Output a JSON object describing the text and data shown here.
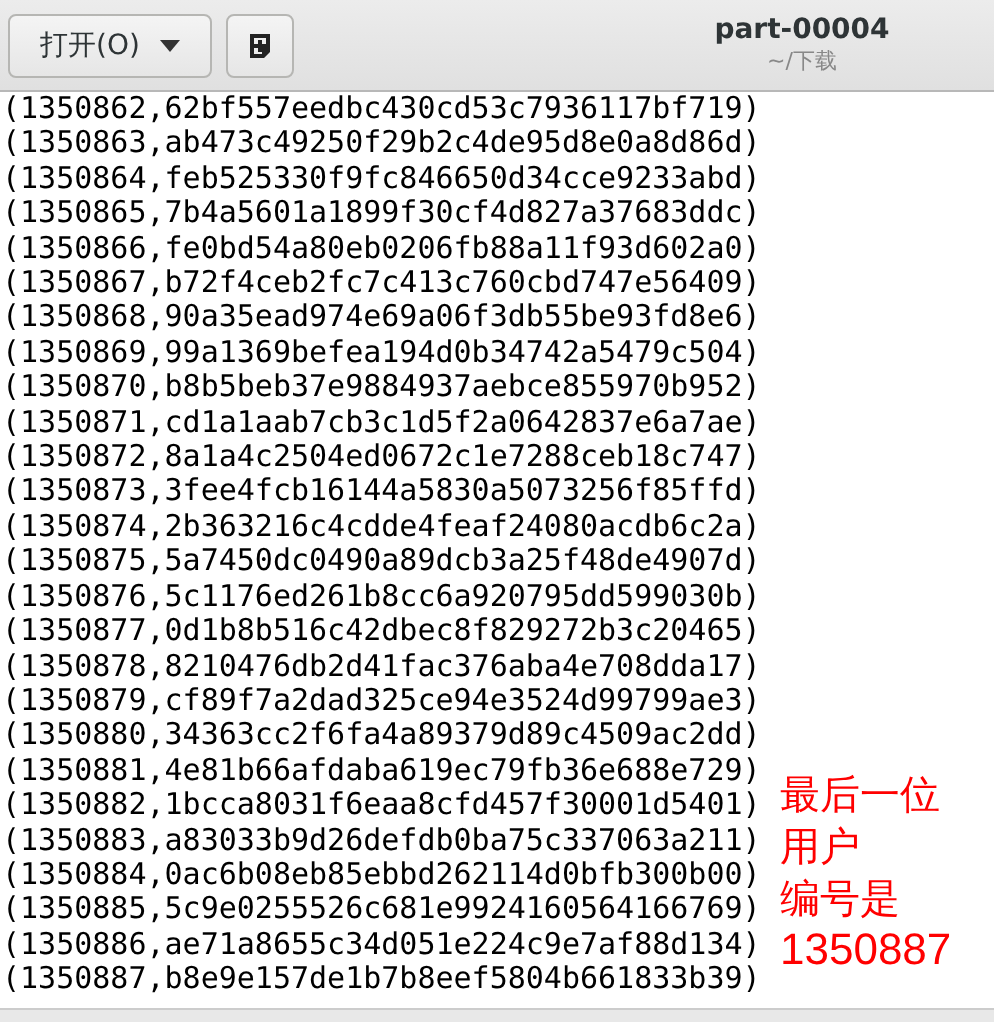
{
  "header_bar": {
    "open_button": {
      "label": "打开(O)"
    },
    "title": "part-00004",
    "subtitle": "~/下载"
  },
  "lines": [
    "(1350862,62bf557eedbc430cd53c7936117bf719)",
    "(1350863,ab473c49250f29b2c4de95d8e0a8d86d)",
    "(1350864,feb525330f9fc846650d34cce9233abd)",
    "(1350865,7b4a5601a1899f30cf4d827a37683ddc)",
    "(1350866,fe0bd54a80eb0206fb88a11f93d602a0)",
    "(1350867,b72f4ceb2fc7c413c760cbd747e56409)",
    "(1350868,90a35ead974e69a06f3db55be93fd8e6)",
    "(1350869,99a1369befea194d0b34742a5479c504)",
    "(1350870,b8b5beb37e9884937aebce855970b952)",
    "(1350871,cd1a1aab7cb3c1d5f2a0642837e6a7ae)",
    "(1350872,8a1a4c2504ed0672c1e7288ceb18c747)",
    "(1350873,3fee4fcb16144a5830a5073256f85ffd)",
    "(1350874,2b363216c4cdde4feaf24080acdb6c2a)",
    "(1350875,5a7450dc0490a89dcb3a25f48de4907d)",
    "(1350876,5c1176ed261b8cc6a920795dd599030b)",
    "(1350877,0d1b8b516c42dbec8f829272b3c20465)",
    "(1350878,8210476db2d41fac376aba4e708dda17)",
    "(1350879,cf89f7a2dad325ce94e3524d99799ae3)",
    "(1350880,34363cc2f6fa4a89379d89c4509ac2dd)",
    "(1350881,4e81b66afdaba619ec79fb36e688e729)",
    "(1350882,1bcca8031f6eaa8cfd457f30001d5401)",
    "(1350883,a83033b9d26defdb0ba75c337063a211)",
    "(1350884,0ac6b08eb85ebbd262114d0bfb300b00)",
    "(1350885,5c9e0255526c681e9924160564166769)",
    "(1350886,ae71a8655c34d051e224c9e7af88d134)",
    "(1350887,b8e9e157de1b7b8eef5804b661833b39)"
  ],
  "annotation": [
    "最后一位",
    "用户",
    "编号是",
    "1350887"
  ]
}
